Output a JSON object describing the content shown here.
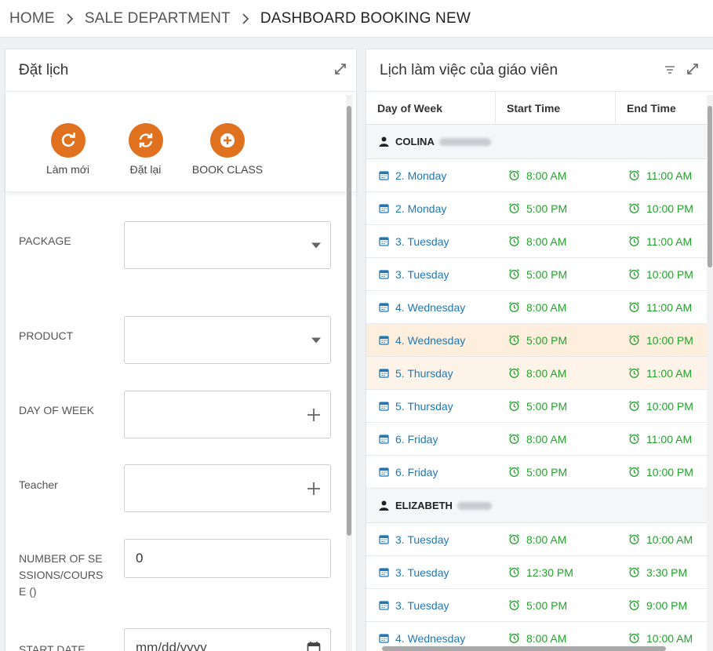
{
  "breadcrumb": {
    "home": "HOME",
    "section": "SALE DEPARTMENT",
    "current": "DASHBOARD BOOKING NEW"
  },
  "booking_panel": {
    "title": "Đặt lịch",
    "actions": {
      "refresh": "Làm mới",
      "reset": "Đặt lại",
      "book": "BOOK CLASS"
    },
    "form": {
      "package_label": "PACKAGE",
      "product_label": "PRODUCT",
      "day_of_week_label": "DAY OF WEEK",
      "teacher_label": "Teacher",
      "sessions_label": "NUMBER OF SESSIONS/COURSE ()",
      "sessions_value": "0",
      "start_date_label": "START DATE",
      "start_date_placeholder": "mm/dd/yyyy"
    }
  },
  "schedule_panel": {
    "title": "Lịch làm việc của giáo viên",
    "columns": {
      "day": "Day of Week",
      "start": "Start Time",
      "end": "End Time"
    },
    "groups": [
      {
        "teacher": "COLINA",
        "rows": [
          {
            "day": "2. Monday",
            "start": "8:00 AM",
            "end": "11:00 AM"
          },
          {
            "day": "2. Monday",
            "start": "5:00 PM",
            "end": "10:00 PM"
          },
          {
            "day": "3. Tuesday",
            "start": "8:00 AM",
            "end": "11:00 AM"
          },
          {
            "day": "3. Tuesday",
            "start": "5:00 PM",
            "end": "10:00 PM"
          },
          {
            "day": "4. Wednesday",
            "start": "8:00 AM",
            "end": "11:00 AM"
          },
          {
            "day": "4. Wednesday",
            "start": "5:00 PM",
            "end": "10:00 PM"
          },
          {
            "day": "5. Thursday",
            "start": "8:00 AM",
            "end": "11:00 AM"
          },
          {
            "day": "5. Thursday",
            "start": "5:00 PM",
            "end": "10:00 PM"
          },
          {
            "day": "6. Friday",
            "start": "8:00 AM",
            "end": "11:00 AM"
          },
          {
            "day": "6. Friday",
            "start": "5:00 PM",
            "end": "10:00 PM"
          }
        ]
      },
      {
        "teacher": "ELIZABETH",
        "rows": [
          {
            "day": "3. Tuesday",
            "start": "8:00 AM",
            "end": "10:00 AM"
          },
          {
            "day": "3. Tuesday",
            "start": "12:30 PM",
            "end": "3:30 PM"
          },
          {
            "day": "3. Tuesday",
            "start": "5:00 PM",
            "end": "9:00 PM"
          },
          {
            "day": "4. Wednesday",
            "start": "8:00 AM",
            "end": "10:00 AM"
          }
        ]
      }
    ]
  },
  "colors": {
    "accent": "#e0711f",
    "day_text": "#1f78b4",
    "time_text": "#22a22a",
    "row_highlight": "#fdeede"
  }
}
